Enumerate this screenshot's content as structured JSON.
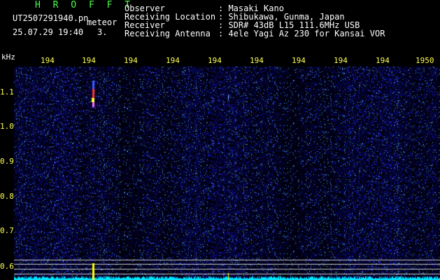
{
  "header": {
    "app_title": "H R O F F T",
    "filename": "UT2507291940.pn",
    "mode": "meteor",
    "datetime": "25.07.29 19:40",
    "count": "3.",
    "fields": [
      {
        "label": "Observer",
        "value": ": Masaki Kano"
      },
      {
        "label": "Receiving Location",
        "value": ": Shibukawa, Gunma, Japan"
      },
      {
        "label": "Receiver",
        "value": ": SDR# 43dB L15 111.6MHz USB"
      },
      {
        "label": "Receiving Antenna",
        "value": ": 4ele Yagi Az 230 for Kansai VOR"
      }
    ]
  },
  "axes": {
    "y_unit": "kHz",
    "y_ticks": [
      "1.1",
      "1.0",
      "0.9",
      "0.8",
      "0.7",
      "0.6"
    ],
    "x_ticks": [
      "194",
      "194",
      "194",
      "194",
      "194",
      "194",
      "194",
      "194",
      "194",
      "1950"
    ]
  },
  "colors": {
    "background": "#000000",
    "noise": "#1a1a8c",
    "spectrum": "#00e5ff",
    "meteor": "#ff4040",
    "text": "#ffffff",
    "title": "#4cff4c",
    "ticks": "#ffff55"
  }
}
